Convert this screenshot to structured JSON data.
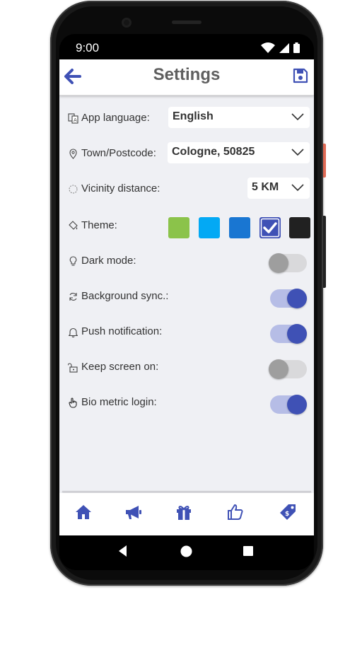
{
  "status_bar": {
    "time": "9:00"
  },
  "header": {
    "title": "Settings",
    "back_icon": "arrow-left-icon",
    "save_icon": "floppy-disk-icon"
  },
  "settings": {
    "app_language": {
      "label": "App language:",
      "value": "English"
    },
    "town_postcode": {
      "label": "Town/Postcode:",
      "value": "Cologne, 50825"
    },
    "vicinity_distance": {
      "label": "Vicinity distance:",
      "value": "5 KM"
    },
    "theme": {
      "label": "Theme:",
      "swatches": [
        "#8bc34a",
        "#03a9f4",
        "#1976d2",
        "#3f51b5",
        "#212121"
      ],
      "selected_index": 3
    },
    "dark_mode": {
      "label": "Dark mode:",
      "on": false
    },
    "background_sync": {
      "label": "Background sync.:",
      "on": true
    },
    "push_notification": {
      "label": "Push notification:",
      "on": true
    },
    "keep_screen_on": {
      "label": "Keep screen on:",
      "on": false
    },
    "biometric_login": {
      "label": "Bio metric login:",
      "on": true
    }
  },
  "bottom_nav": [
    "home-icon",
    "megaphone-icon",
    "gift-icon",
    "thumbs-up-icon",
    "price-tag-icon"
  ],
  "colors": {
    "accent": "#3f51b5",
    "accent_light": "#b6bde6",
    "toggle_off_knob": "#9e9e9e",
    "toggle_off_track": "#d9d9db",
    "background": "#eff0f4",
    "title_text": "#5f5f5f"
  }
}
